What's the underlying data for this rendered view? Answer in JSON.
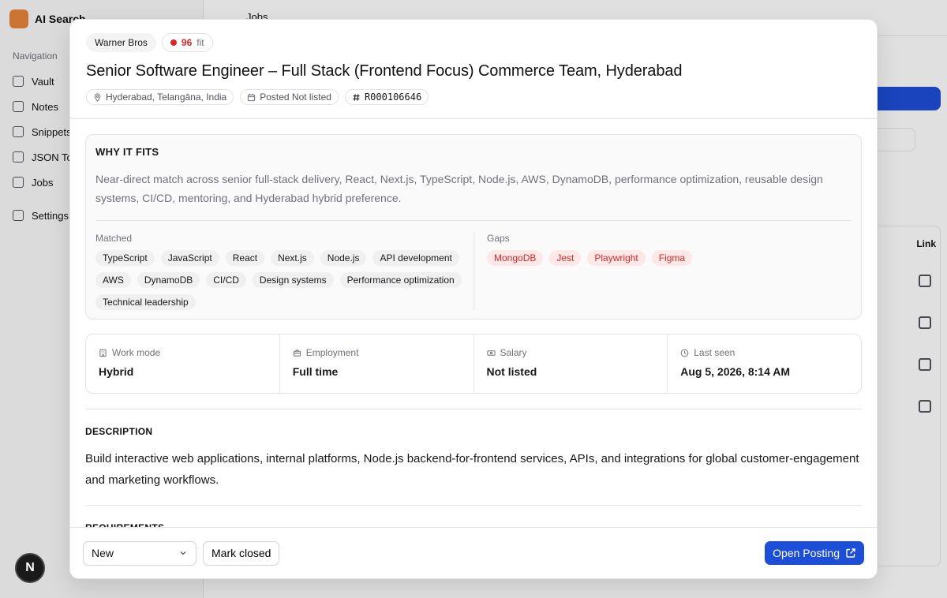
{
  "background": {
    "brand": "AI Search",
    "nav_heading": "Navigation",
    "nav_items": [
      "Vault",
      "Notes",
      "Snippets",
      "JSON Tools",
      "Jobs",
      "Settings"
    ],
    "topbar_title": "Jobs",
    "table_header": "Link"
  },
  "dev_badge": "N",
  "header": {
    "company": "Warner Bros",
    "fit_score": "96",
    "fit_label": "fit",
    "title": "Senior Software Engineer – Full Stack (Frontend Focus) Commerce Team, Hyderabad",
    "location": "Hyderabad, Telangāna, India",
    "posted": "Posted Not listed",
    "job_id": "R000106646"
  },
  "fit": {
    "heading": "WHY IT FITS",
    "summary": "Near-direct match across senior full-stack delivery, React, Next.js, TypeScript, Node.js, AWS, DynamoDB, performance optimization, reusable design systems, CI/CD, mentoring, and Hyderabad hybrid preference.",
    "matched_label": "Matched",
    "matched": [
      "TypeScript",
      "JavaScript",
      "React",
      "Next.js",
      "Node.js",
      "API development",
      "AWS",
      "DynamoDB",
      "CI/CD",
      "Design systems",
      "Performance optimization",
      "Technical leadership"
    ],
    "gaps_label": "Gaps",
    "gaps": [
      "MongoDB",
      "Jest",
      "Playwright",
      "Figma"
    ]
  },
  "facts": {
    "work_mode_label": "Work mode",
    "work_mode": "Hybrid",
    "employment_label": "Employment",
    "employment": "Full time",
    "salary_label": "Salary",
    "salary": "Not listed",
    "last_seen_label": "Last seen",
    "last_seen": "Aug 5, 2026, 8:14 AM"
  },
  "description": {
    "heading": "DESCRIPTION",
    "text": "Build interactive web applications, internal platforms, Node.js backend-for-frontend services, APIs, and integrations for global customer-engagement and marketing workflows."
  },
  "requirements": {
    "heading": "REQUIREMENTS"
  },
  "footer": {
    "status_value": "New",
    "mark_closed": "Mark closed",
    "open_posting": "Open Posting"
  },
  "colors": {
    "accent": "#1d4ed8",
    "fit_red": "#dc2626",
    "gap_bg": "#fde8e8"
  }
}
